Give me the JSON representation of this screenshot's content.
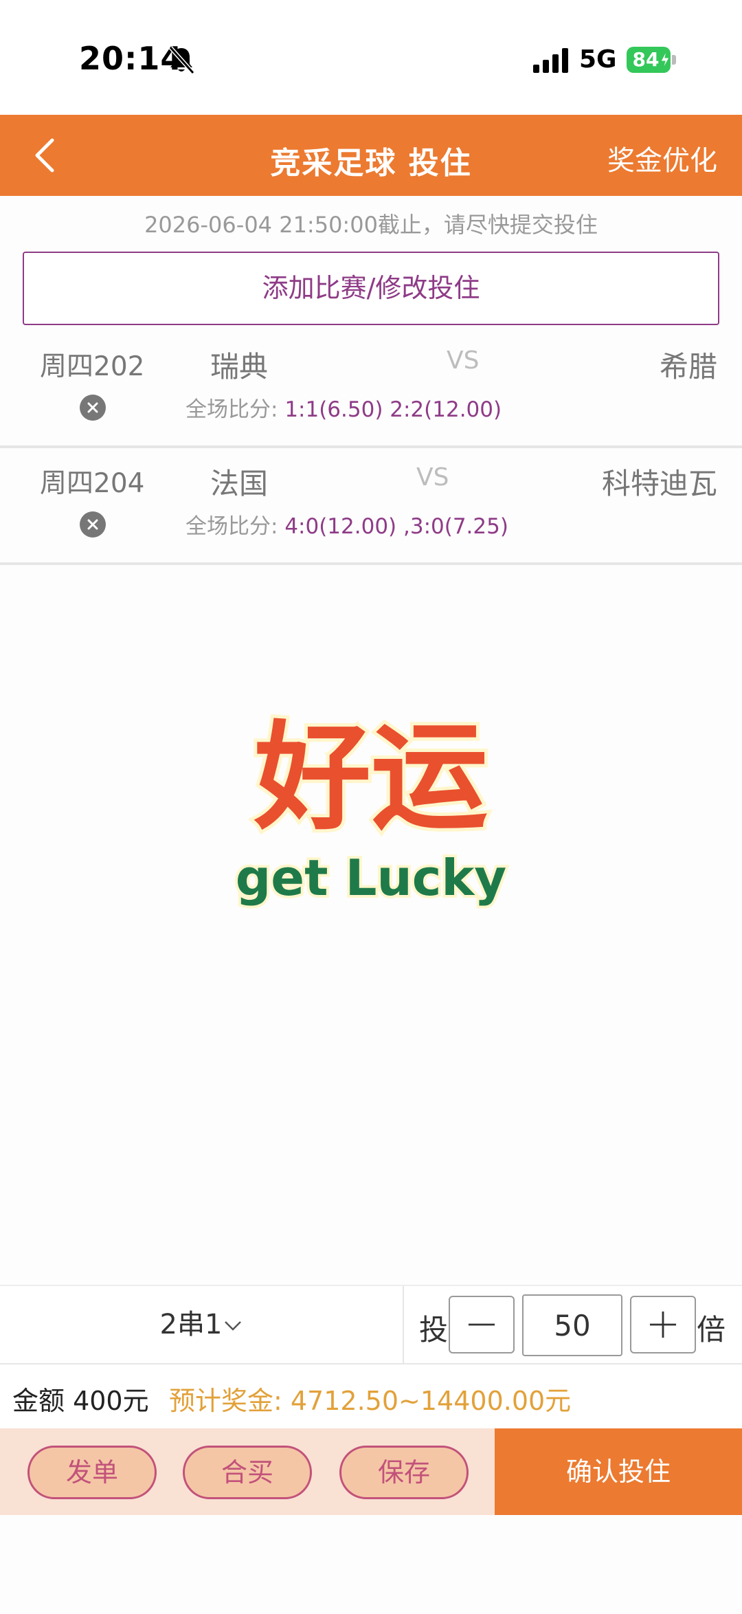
{
  "status_bar": {
    "time": "20:14",
    "network": "5G",
    "battery": "84"
  },
  "header": {
    "title": "竞采足球 投住",
    "action": "奖金优化"
  },
  "deadline_notice": "2026-06-04 21:50:00截止，请尽快提交投住",
  "add_match_label": "添加比赛/修改投住",
  "matches": [
    {
      "number": "周四202",
      "home": "瑞典",
      "vs": "VS",
      "away": "希腊",
      "score_label": "全场比分: ",
      "scores": "1:1(6.50) 2:2(12.00)"
    },
    {
      "number": "周四204",
      "home": "法国",
      "vs": "VS",
      "away": "科特迪瓦",
      "score_label": "全场比分: ",
      "scores": "4:0(12.00) ,3:0(7.25)"
    }
  ],
  "logo": {
    "title": "好运",
    "subtitle": "get Lucky",
    "colors": {
      "title": "#e9502e",
      "subtitle": "#1f7a4a"
    }
  },
  "bet_bar": {
    "pass_type": "2串1",
    "multi_label": "投",
    "times_label": "倍",
    "multiplier": "50"
  },
  "amount": {
    "amount_text": "金额 400元",
    "prize_text": "预计奖金: 4712.50~14400.00元"
  },
  "actions": {
    "publish": "发单",
    "group_buy": "合买",
    "save": "保存",
    "confirm": "确认投住"
  },
  "colors": {
    "primary": "#ec7a30",
    "accent": "#8e3b87",
    "prize": "#e2a13a"
  }
}
